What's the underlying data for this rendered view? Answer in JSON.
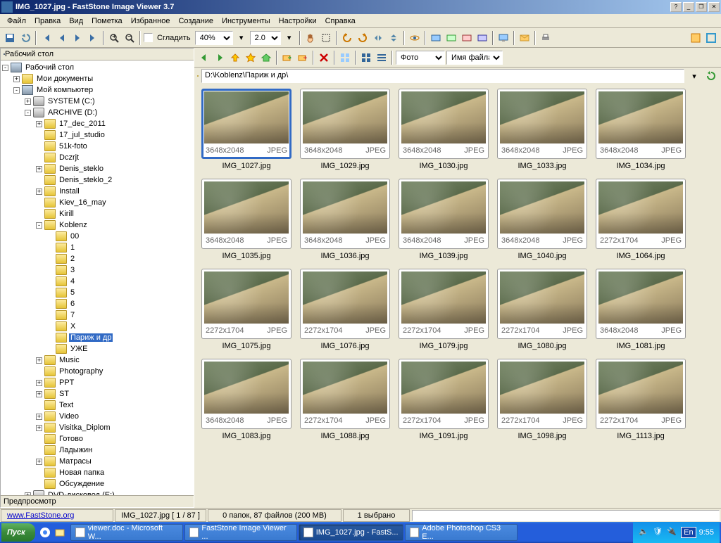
{
  "title": "IMG_1027.jpg  -  FastStone Image Viewer 3.7",
  "menu": [
    "Файл",
    "Правка",
    "Вид",
    "Пометка",
    "Избранное",
    "Создание",
    "Инструменты",
    "Настройки",
    "Справка"
  ],
  "toolbar1": {
    "zoom_pct": "40%",
    "zoom_step": "2.0",
    "smooth_label": "Сгладить"
  },
  "tree_header": "Рабочий стол",
  "tree": [
    {
      "d": 0,
      "e": "-",
      "i": "comp",
      "t": "Рабочий стол"
    },
    {
      "d": 1,
      "e": "+",
      "i": "folder",
      "t": "Мои документы"
    },
    {
      "d": 1,
      "e": "-",
      "i": "comp",
      "t": "Мой компьютер"
    },
    {
      "d": 2,
      "e": "+",
      "i": "drive",
      "t": "SYSTEM (C:)"
    },
    {
      "d": 2,
      "e": "-",
      "i": "drive",
      "t": "ARCHIVE (D:)"
    },
    {
      "d": 3,
      "e": "+",
      "i": "folder",
      "t": "17_dec_2011"
    },
    {
      "d": 3,
      "e": " ",
      "i": "folder",
      "t": "17_jul_studio"
    },
    {
      "d": 3,
      "e": " ",
      "i": "folder",
      "t": "51k-foto"
    },
    {
      "d": 3,
      "e": " ",
      "i": "folder",
      "t": "Dczrjt"
    },
    {
      "d": 3,
      "e": "+",
      "i": "folder",
      "t": "Denis_steklo"
    },
    {
      "d": 3,
      "e": " ",
      "i": "folder",
      "t": "Denis_steklo_2"
    },
    {
      "d": 3,
      "e": "+",
      "i": "folder",
      "t": "Install"
    },
    {
      "d": 3,
      "e": " ",
      "i": "folder",
      "t": "Kiev_16_may"
    },
    {
      "d": 3,
      "e": " ",
      "i": "folder",
      "t": "Kirill"
    },
    {
      "d": 3,
      "e": "-",
      "i": "folder",
      "t": "Koblenz"
    },
    {
      "d": 4,
      "e": " ",
      "i": "folder",
      "t": "00"
    },
    {
      "d": 4,
      "e": " ",
      "i": "folder",
      "t": "1"
    },
    {
      "d": 4,
      "e": " ",
      "i": "folder",
      "t": "2"
    },
    {
      "d": 4,
      "e": " ",
      "i": "folder",
      "t": "3"
    },
    {
      "d": 4,
      "e": " ",
      "i": "folder",
      "t": "4"
    },
    {
      "d": 4,
      "e": " ",
      "i": "folder",
      "t": "5"
    },
    {
      "d": 4,
      "e": " ",
      "i": "folder",
      "t": "6"
    },
    {
      "d": 4,
      "e": " ",
      "i": "folder",
      "t": "7"
    },
    {
      "d": 4,
      "e": " ",
      "i": "folder",
      "t": "X"
    },
    {
      "d": 4,
      "e": " ",
      "i": "folder",
      "t": "Париж и др",
      "sel": true
    },
    {
      "d": 4,
      "e": " ",
      "i": "folder",
      "t": "УЖЕ"
    },
    {
      "d": 3,
      "e": "+",
      "i": "folder",
      "t": "Music"
    },
    {
      "d": 3,
      "e": " ",
      "i": "folder",
      "t": "Photography"
    },
    {
      "d": 3,
      "e": "+",
      "i": "folder",
      "t": "PPT"
    },
    {
      "d": 3,
      "e": "+",
      "i": "folder",
      "t": "ST"
    },
    {
      "d": 3,
      "e": " ",
      "i": "folder",
      "t": "Text"
    },
    {
      "d": 3,
      "e": "+",
      "i": "folder",
      "t": "Video"
    },
    {
      "d": 3,
      "e": "+",
      "i": "folder",
      "t": "Visitka_Diplom"
    },
    {
      "d": 3,
      "e": " ",
      "i": "folder",
      "t": "Готово"
    },
    {
      "d": 3,
      "e": " ",
      "i": "folder",
      "t": "Ладыжин"
    },
    {
      "d": 3,
      "e": "+",
      "i": "folder",
      "t": "Матрасы"
    },
    {
      "d": 3,
      "e": " ",
      "i": "folder",
      "t": "Новая папка"
    },
    {
      "d": 3,
      "e": " ",
      "i": "folder",
      "t": "Обсуждение"
    },
    {
      "d": 2,
      "e": "+",
      "i": "drive",
      "t": "DVD-дисковод (E:)"
    }
  ],
  "preview_label": "Предпросмотр",
  "path": "D:\\Koblenz\\Париж и др\\",
  "filter": "Фото",
  "sort": "Имя файла",
  "thumbs": [
    {
      "name": "IMG_1027.jpg",
      "dim": "3648x2048",
      "fmt": "JPEG",
      "sel": true
    },
    {
      "name": "IMG_1029.jpg",
      "dim": "3648x2048",
      "fmt": "JPEG"
    },
    {
      "name": "IMG_1030.jpg",
      "dim": "3648x2048",
      "fmt": "JPEG"
    },
    {
      "name": "IMG_1033.jpg",
      "dim": "3648x2048",
      "fmt": "JPEG"
    },
    {
      "name": "IMG_1034.jpg",
      "dim": "3648x2048",
      "fmt": "JPEG"
    },
    {
      "name": "IMG_1035.jpg",
      "dim": "3648x2048",
      "fmt": "JPEG"
    },
    {
      "name": "IMG_1036.jpg",
      "dim": "3648x2048",
      "fmt": "JPEG"
    },
    {
      "name": "IMG_1039.jpg",
      "dim": "3648x2048",
      "fmt": "JPEG"
    },
    {
      "name": "IMG_1040.jpg",
      "dim": "3648x2048",
      "fmt": "JPEG"
    },
    {
      "name": "IMG_1064.jpg",
      "dim": "2272x1704",
      "fmt": "JPEG"
    },
    {
      "name": "IMG_1075.jpg",
      "dim": "2272x1704",
      "fmt": "JPEG"
    },
    {
      "name": "IMG_1076.jpg",
      "dim": "2272x1704",
      "fmt": "JPEG"
    },
    {
      "name": "IMG_1079.jpg",
      "dim": "2272x1704",
      "fmt": "JPEG"
    },
    {
      "name": "IMG_1080.jpg",
      "dim": "2272x1704",
      "fmt": "JPEG"
    },
    {
      "name": "IMG_1081.jpg",
      "dim": "3648x2048",
      "fmt": "JPEG"
    },
    {
      "name": "IMG_1083.jpg",
      "dim": "3648x2048",
      "fmt": "JPEG"
    },
    {
      "name": "IMG_1088.jpg",
      "dim": "2272x1704",
      "fmt": "JPEG"
    },
    {
      "name": "IMG_1091.jpg",
      "dim": "2272x1704",
      "fmt": "JPEG"
    },
    {
      "name": "IMG_1098.jpg",
      "dim": "2272x1704",
      "fmt": "JPEG"
    },
    {
      "name": "IMG_1113.jpg",
      "dim": "2272x1704",
      "fmt": "JPEG"
    }
  ],
  "status": {
    "link": "www.FastStone.org",
    "counter": "IMG_1027.jpg [ 1 / 87 ]",
    "summary": "0 папок, 87 файлов (200 MB)",
    "selected": "1 выбрано"
  },
  "taskbar": {
    "start": "Пуск",
    "items": [
      {
        "t": "viewer.doc - Microsoft W..."
      },
      {
        "t": "FastStone Image Viewer ..."
      },
      {
        "t": "IMG_1027.jpg - FastS...",
        "active": true
      },
      {
        "t": "Adobe Photoshop CS3 E..."
      }
    ],
    "lang": "En",
    "time": "9:55"
  }
}
